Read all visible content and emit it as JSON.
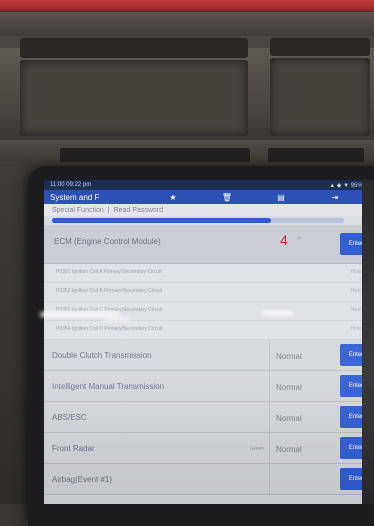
{
  "status_bar": {
    "time": "11:00 09:22 pm",
    "indicators": "▲ ◆ ▼ 95% ■"
  },
  "app_bar": {
    "title": "System and F",
    "icons": [
      "star-icon",
      "trash-icon",
      "doc-icon",
      "exit-icon"
    ],
    "glyphs": [
      "★",
      "🗑",
      "▤",
      "⇥"
    ]
  },
  "breadcrumb": {
    "item1": "Special Function",
    "separator": "|",
    "item2": "Read Password"
  },
  "progress": {
    "fraction": 0.75
  },
  "ecm": {
    "label": "ECM (Engine Control Module)",
    "count": "4",
    "enter": "Enter",
    "dtcs": [
      {
        "code": "P0351 Ignition Coil A Primary/Secondary Circuit",
        "status": "History"
      },
      {
        "code": "P0352 Ignition Coil B Primary/Secondary Circuit",
        "status": "History"
      },
      {
        "code": "P0353 Ignition Coil C Primary/Secondary Circuit",
        "status": "History"
      },
      {
        "code": "P0354 Ignition Coil D Primary/Secondary Circuit",
        "status": "History"
      }
    ]
  },
  "modules": [
    {
      "label": "Double Clutch Transmission",
      "status": "Normal",
      "enter": "Enter",
      "extra": ""
    },
    {
      "label": "Intelligent Manual Transmission",
      "status": "Normal",
      "enter": "Enter",
      "extra": ""
    },
    {
      "label": "ABS/ESC",
      "status": "Normal",
      "enter": "Enter",
      "extra": ""
    },
    {
      "label": "Front Radar",
      "status": "Normal",
      "enter": "Enter",
      "extra": "Green"
    },
    {
      "label": "Airbag(Event #1)",
      "status": "",
      "enter": "Enter",
      "extra": ""
    }
  ]
}
